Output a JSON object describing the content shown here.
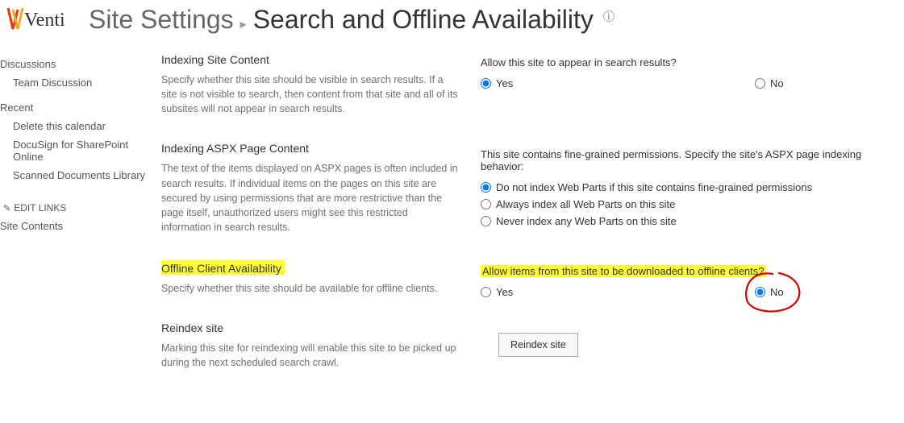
{
  "brand": "Venti",
  "breadcrumb": {
    "parent": "Site Settings",
    "current": "Search and Offline Availability"
  },
  "sidebar": {
    "groups": [
      {
        "head": "Discussions",
        "items": [
          "Team Discussion"
        ]
      },
      {
        "head": "Recent",
        "items": [
          "Delete this calendar",
          "DocuSign for SharePoint Online",
          "Scanned Documents Library"
        ]
      }
    ],
    "edit_links": "EDIT LINKS",
    "site_contents": "Site Contents"
  },
  "sections": {
    "indexing_site": {
      "title": "Indexing Site Content",
      "desc": "Specify whether this site should be visible in search results. If a site is not visible to search, then content from that site and all of its subsites will not appear in search results.",
      "question": "Allow this site to appear in search results?",
      "yes": "Yes",
      "no": "No",
      "selected": "yes"
    },
    "indexing_aspx": {
      "title": "Indexing ASPX Page Content",
      "desc": "The text of the items displayed on ASPX pages is often included in search results. If individual items on the pages on this site are secured by using permissions that are more restrictive than the page itself, unauthorized users might see this restricted information in search results.",
      "question": "This site contains fine-grained permissions. Specify the site's ASPX page indexing behavior:",
      "options": [
        "Do not index Web Parts if this site contains fine-grained permissions",
        "Always index all Web Parts on this site",
        "Never index any Web Parts on this site"
      ],
      "selected": 0
    },
    "offline": {
      "title": "Offline Client Availability",
      "desc": "Specify whether this site should be available for offline clients.",
      "question": "Allow items from this site to be downloaded to offline clients?",
      "yes": "Yes",
      "no": "No",
      "selected": "no"
    },
    "reindex": {
      "title": "Reindex site",
      "desc": "Marking this site for reindexing will enable this site to be picked up during the next scheduled search crawl.",
      "button": "Reindex site"
    }
  }
}
